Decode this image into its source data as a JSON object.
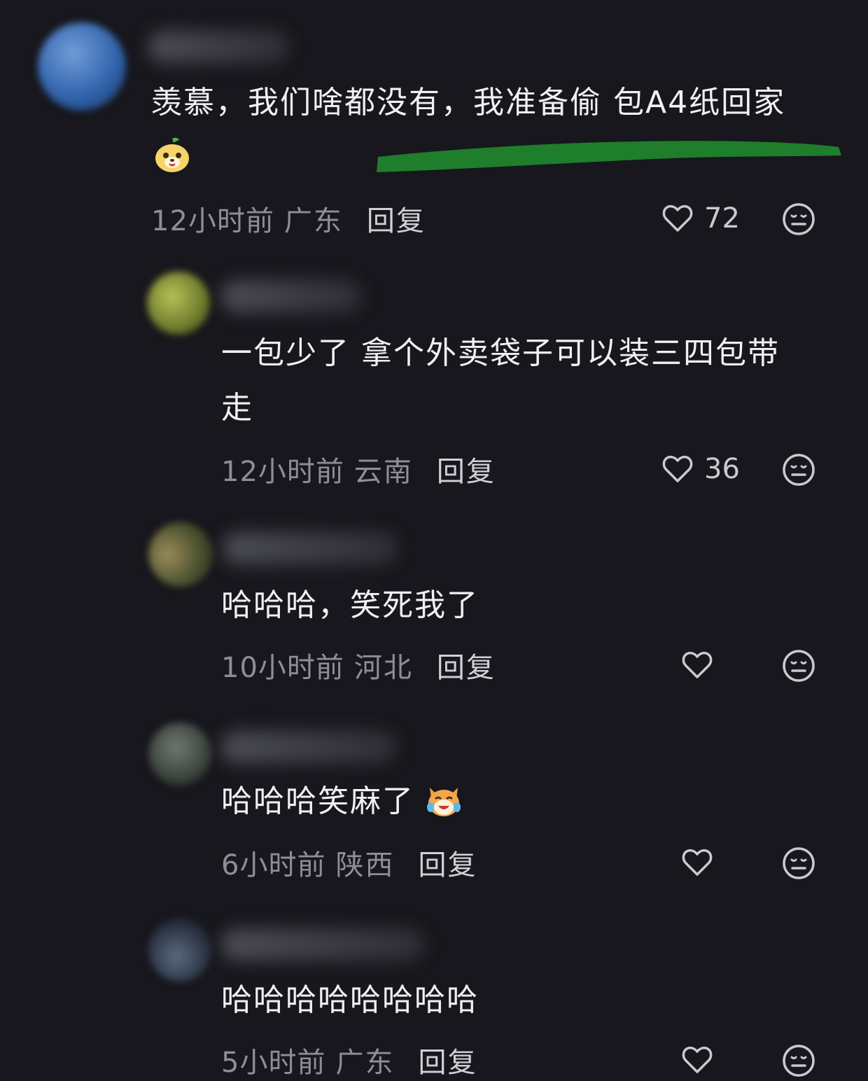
{
  "comments": [
    {
      "text_line1": "羡慕，我们啥都没有，我准备偷 包A4纸回家",
      "emoji": "smiling-dog-emoji",
      "time": "12小时前",
      "region": "广东",
      "reply": "回复",
      "likes": "72"
    },
    {
      "text_line1": "一包少了 拿个外卖袋子可以装三四包带",
      "text_line2": "走",
      "time": "12小时前",
      "region": "云南",
      "reply": "回复",
      "likes": "36"
    },
    {
      "text_line1": "哈哈哈，笑死我了",
      "time": "10小时前",
      "region": "河北",
      "reply": "回复",
      "likes": ""
    },
    {
      "text_line1": "哈哈哈笑麻了",
      "emoji": "laughing-cat-emoji",
      "time": "6小时前",
      "region": "陕西",
      "reply": "回复",
      "likes": ""
    },
    {
      "text_line1": "哈哈哈哈哈哈哈哈",
      "time": "5小时前",
      "region": "广东",
      "reply": "回复",
      "likes": ""
    }
  ],
  "icons": {
    "like": "heart-outline-icon",
    "dislike": "meh-face-icon"
  },
  "colors": {
    "background": "#17171d",
    "highlight": "#1f8a2e"
  }
}
